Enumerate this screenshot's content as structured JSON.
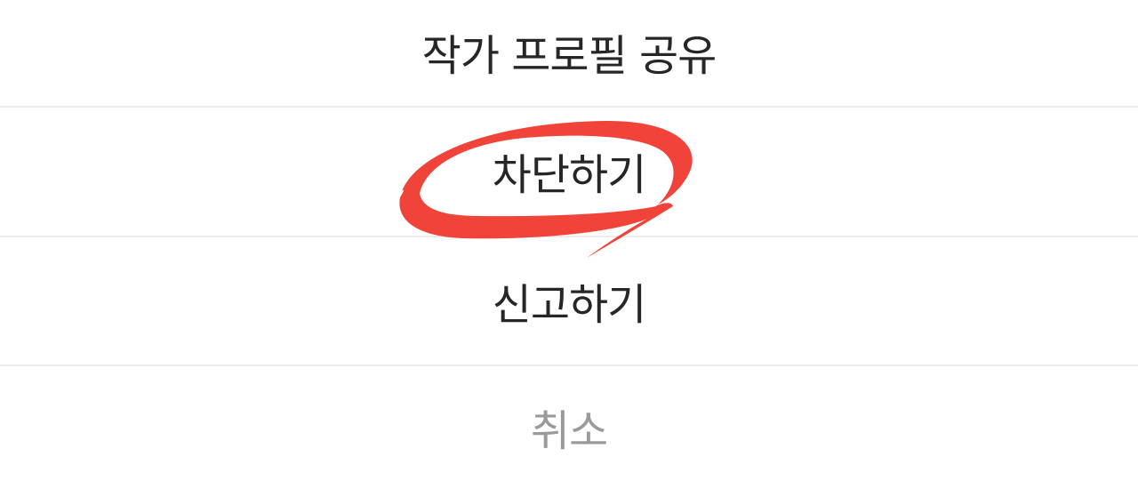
{
  "menu": {
    "items": [
      {
        "label": "작가 프로필 공유"
      },
      {
        "label": "차단하기"
      },
      {
        "label": "신고하기"
      }
    ],
    "cancel_label": "취소"
  },
  "annotation": {
    "shape": "hand-drawn-circle",
    "target": "차단하기",
    "color": "#f0443a"
  }
}
